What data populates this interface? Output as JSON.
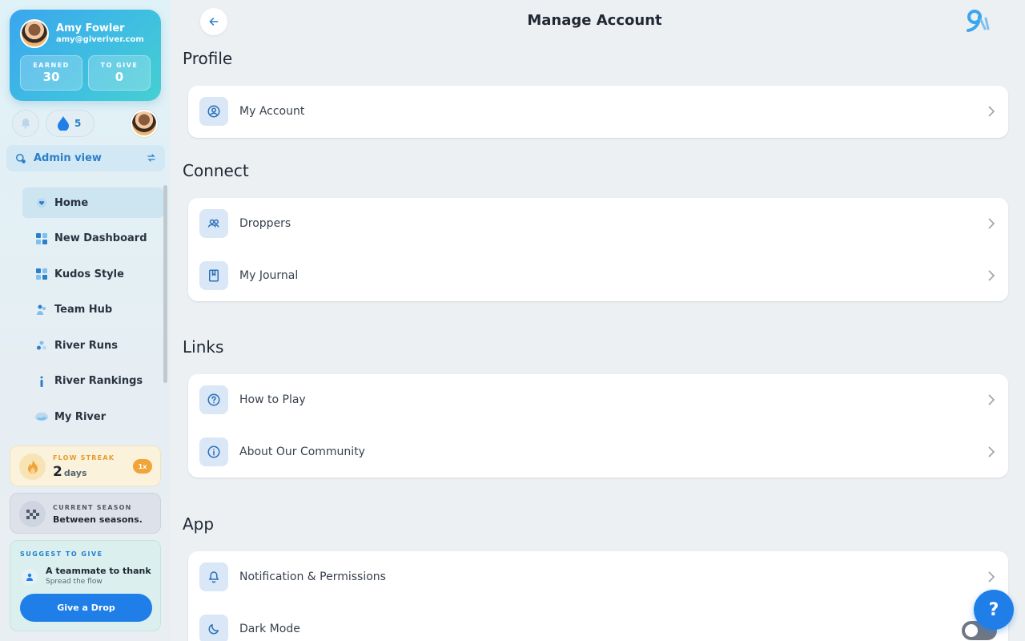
{
  "user": {
    "name": "Amy Fowler",
    "email": "amy@giveriver.com",
    "earned_label": "EARNED",
    "earned_value": "30",
    "to_give_label": "TO GIVE",
    "to_give_value": "0",
    "drops_count": "5"
  },
  "admin_view": {
    "label": "Admin view"
  },
  "nav": [
    {
      "label": "Home",
      "icon": "heart-drop-icon"
    },
    {
      "label": "New Dashboard",
      "icon": "dashboard-grid-icon"
    },
    {
      "label": "Kudos Style",
      "icon": "dashboard-grid-icon"
    },
    {
      "label": "Team Hub",
      "icon": "people-icon"
    },
    {
      "label": "River Runs",
      "icon": "drops-icon"
    },
    {
      "label": "River Rankings",
      "icon": "ranking-icon"
    },
    {
      "label": "My River",
      "icon": "river-icon"
    }
  ],
  "streak": {
    "label": "FLOW STREAK",
    "value": "2",
    "unit": "days",
    "badge": "1x"
  },
  "season": {
    "label": "CURRENT SEASON",
    "value": "Between seasons."
  },
  "suggest": {
    "label": "SUGGEST TO GIVE",
    "title": "A teammate to thank",
    "subtitle": "Spread the flow",
    "button": "Give a Drop"
  },
  "header": {
    "title": "Manage Account"
  },
  "sections": {
    "profile": {
      "title": "Profile",
      "rows": [
        {
          "label": "My Account",
          "icon": "user-circle-icon"
        }
      ]
    },
    "connect": {
      "title": "Connect",
      "rows": [
        {
          "label": "Droppers",
          "icon": "people-icon"
        },
        {
          "label": "My Journal",
          "icon": "journal-icon"
        }
      ]
    },
    "links": {
      "title": "Links",
      "rows": [
        {
          "label": "How to Play",
          "icon": "question-circle-icon"
        },
        {
          "label": "About Our Community",
          "icon": "info-circle-icon"
        }
      ]
    },
    "app": {
      "title": "App",
      "rows": [
        {
          "label": "Notification & Permissions",
          "icon": "bell-icon"
        },
        {
          "label": "Dark Mode",
          "icon": "moon-icon",
          "toggle": false
        }
      ]
    }
  },
  "help": {
    "label": "?"
  },
  "colors": {
    "accent": "#1f7ee8",
    "icon_bg": "#d9e7f6",
    "streak": "#f0a43a"
  }
}
